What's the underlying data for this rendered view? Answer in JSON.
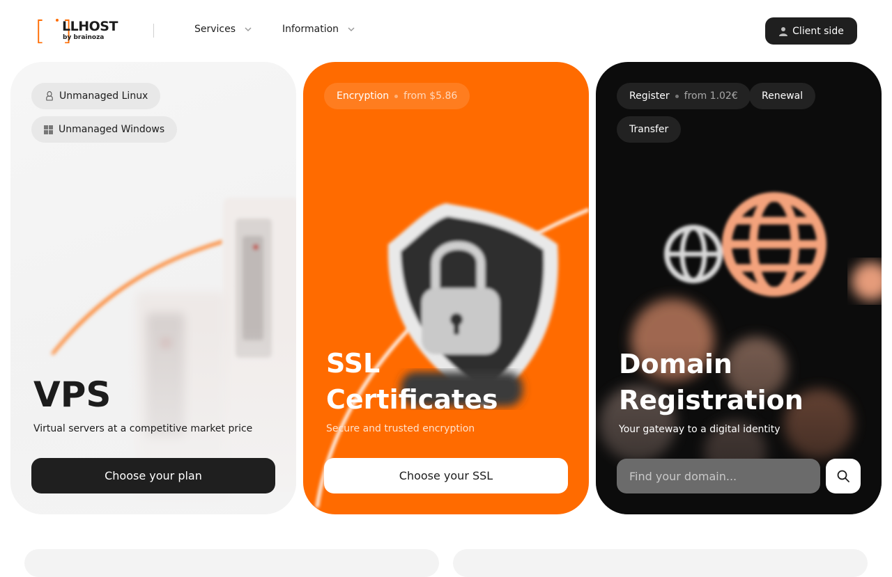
{
  "brand": {
    "name": "LLHOST",
    "sub": "by brainoza",
    "accent": "#ff6b00"
  },
  "nav": {
    "items": [
      {
        "label": "Services"
      },
      {
        "label": "Information"
      }
    ],
    "client_button": "Client side"
  },
  "cards": {
    "vps": {
      "tags": [
        {
          "label": "Unmanaged Linux",
          "icon": "linux-icon"
        },
        {
          "label": "Unmanaged Windows",
          "icon": "windows-icon"
        }
      ],
      "title": "VPS",
      "subtitle": "Virtual servers at a competitive market price",
      "cta": "Choose your plan"
    },
    "ssl": {
      "tag": {
        "label": "Encryption",
        "price": "from $5.86"
      },
      "title_line1": "SSL",
      "title_line2": "Certificates",
      "subtitle": "Secure and trusted encryption",
      "cta": "Choose your SSL"
    },
    "domain": {
      "tags": [
        {
          "label": "Register",
          "price": "from 1.02€"
        },
        {
          "label": "Renewal"
        },
        {
          "label": "Transfer"
        }
      ],
      "title_line1": "Domain",
      "title_line2": "Registration",
      "subtitle": "Your gateway to a digital identity",
      "search_placeholder": "Find your domain..."
    }
  }
}
